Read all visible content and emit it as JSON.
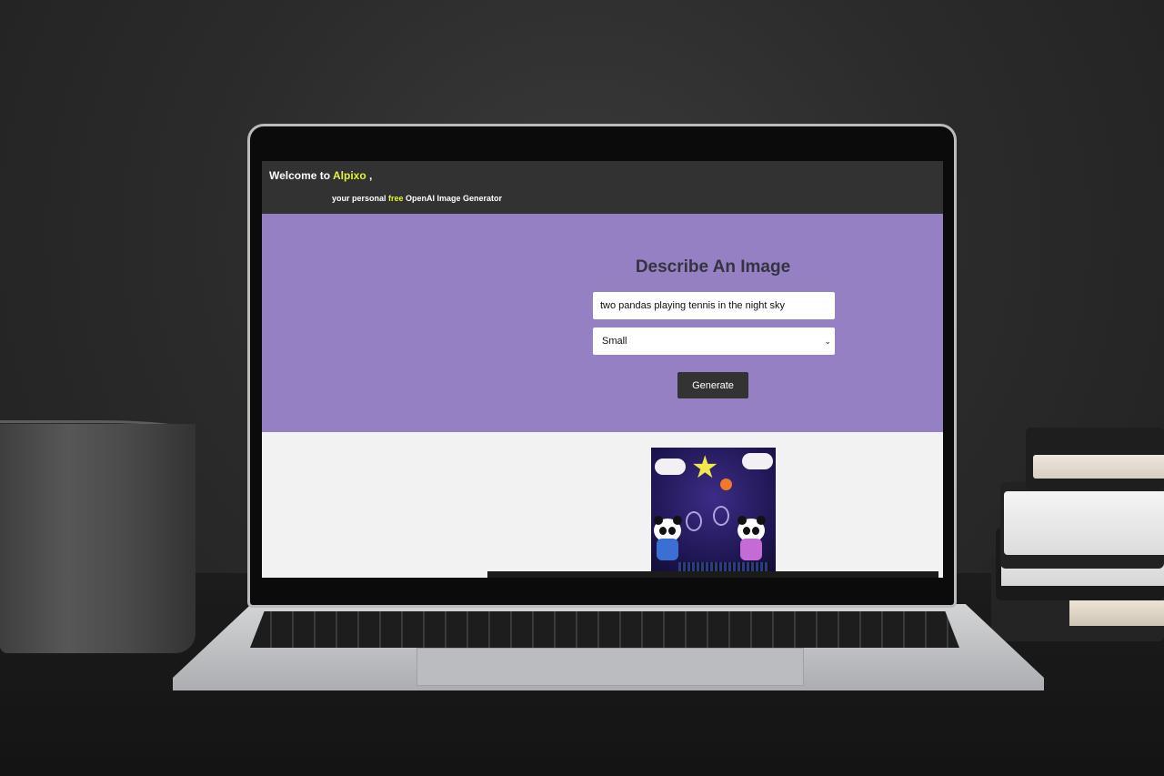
{
  "app": {
    "welcome_prefix": "Welcome to ",
    "brand": "Alpixo",
    "welcome_suffix": " ,",
    "tagline_prefix": "your personal ",
    "tagline_free": "free",
    "tagline_suffix": " OpenAI Image Generator"
  },
  "form": {
    "title": "Describe An Image",
    "prompt_value": "two pandas playing tennis in the night sky",
    "size_selected": "Small",
    "generate_label": "Generate"
  },
  "colors": {
    "header_bg": "#323232",
    "hero_bg": "#9480c2",
    "accent": "#e4f23a",
    "button_bg": "#333333"
  },
  "icons": {
    "select_arrow": "chevron-down-icon"
  }
}
